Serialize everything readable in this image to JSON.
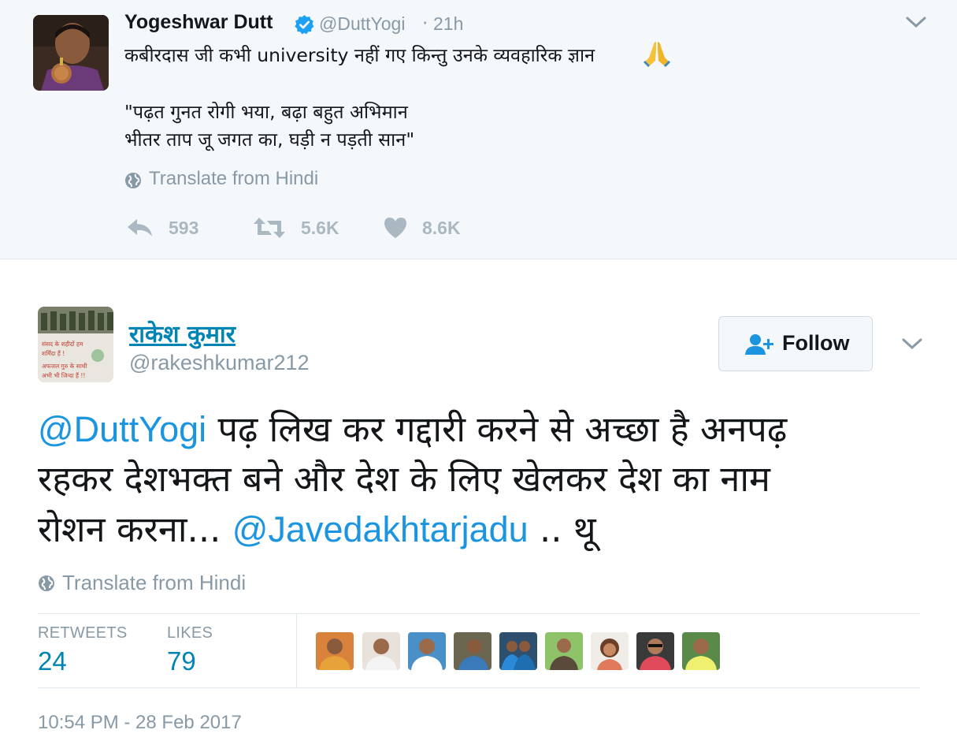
{
  "parent_tweet": {
    "name": "Yogeshwar Dutt",
    "handle": "@DuttYogi",
    "separator": "·",
    "time": "21h",
    "text_line1": "कबीरदास जी कभी university नहीं गए किन्तु उनके व्यवहारिक ज्ञान",
    "text_line2": "\"पढ़त गुनत रोगी भया, बढ़ा बहुत अभिमान",
    "text_line3": "भीतर ताप जू जगत का, घड़ी न पड़ती सान\"",
    "translate_label": "Translate from Hindi",
    "replies": "593",
    "retweets": "5.6K",
    "likes": "8.6K"
  },
  "main_tweet": {
    "name": "राकेश कुमार",
    "handle": "@rakeshkumar212",
    "follow_label": "Follow",
    "line1_mention": "@DuttYogi",
    "line1_text": " पढ़ लिख कर गद्दारी करने से अच्छा है अनपढ़",
    "line2_text": "रहकर देशभक्त बने और देश के लिए खेलकर देश का नाम",
    "line3_text_a": "रोशन करना... ",
    "line3_mention": "@Javedakhtarjadu",
    "line3_text_b": " .. थू",
    "avatar_text_1": "संसद के शहीदों हम",
    "avatar_text_2": "शर्मिंदा हैं !",
    "avatar_text_3": "अफजल गुरु के साथी",
    "avatar_text_4": "अभी भी जिन्दा हैं !!",
    "translate_label": "Translate from Hindi",
    "retweets_label": "RETWEETS",
    "retweets_count": "24",
    "likes_label": "LIKES",
    "likes_count": "79",
    "timestamp": "10:54 PM - 28 Feb 2017"
  },
  "colors": {
    "link": "#1b95e0",
    "stat_blue": "#0084b4",
    "muted": "#8899a6",
    "verified": "#1da1f2",
    "parent_bg": "#f5f8fa"
  },
  "icons": [
    "verified-badge-icon",
    "chevron-down-icon",
    "praying-hands-emoji",
    "globe-icon",
    "reply-icon",
    "retweet-icon",
    "heart-icon",
    "follow-person-plus-icon"
  ]
}
